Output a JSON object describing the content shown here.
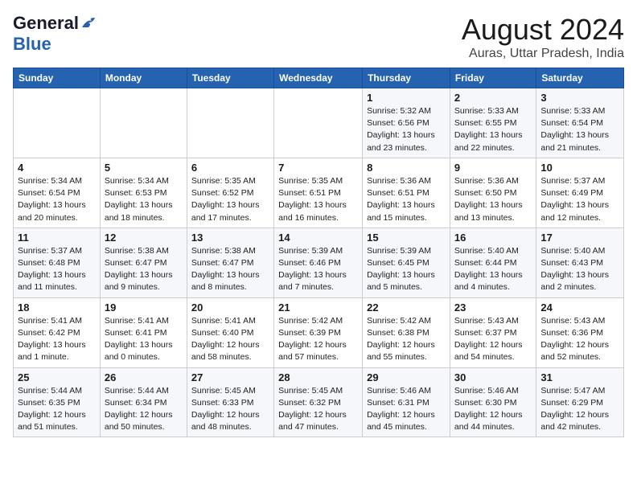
{
  "app": {
    "logo_line1": "General",
    "logo_line2": "Blue",
    "main_title": "August 2024",
    "subtitle": "Auras, Uttar Pradesh, India"
  },
  "calendar": {
    "headers": [
      "Sunday",
      "Monday",
      "Tuesday",
      "Wednesday",
      "Thursday",
      "Friday",
      "Saturday"
    ],
    "weeks": [
      [
        {
          "day": "",
          "info": ""
        },
        {
          "day": "",
          "info": ""
        },
        {
          "day": "",
          "info": ""
        },
        {
          "day": "",
          "info": ""
        },
        {
          "day": "1",
          "info": "Sunrise: 5:32 AM\nSunset: 6:56 PM\nDaylight: 13 hours\nand 23 minutes."
        },
        {
          "day": "2",
          "info": "Sunrise: 5:33 AM\nSunset: 6:55 PM\nDaylight: 13 hours\nand 22 minutes."
        },
        {
          "day": "3",
          "info": "Sunrise: 5:33 AM\nSunset: 6:54 PM\nDaylight: 13 hours\nand 21 minutes."
        }
      ],
      [
        {
          "day": "4",
          "info": "Sunrise: 5:34 AM\nSunset: 6:54 PM\nDaylight: 13 hours\nand 20 minutes."
        },
        {
          "day": "5",
          "info": "Sunrise: 5:34 AM\nSunset: 6:53 PM\nDaylight: 13 hours\nand 18 minutes."
        },
        {
          "day": "6",
          "info": "Sunrise: 5:35 AM\nSunset: 6:52 PM\nDaylight: 13 hours\nand 17 minutes."
        },
        {
          "day": "7",
          "info": "Sunrise: 5:35 AM\nSunset: 6:51 PM\nDaylight: 13 hours\nand 16 minutes."
        },
        {
          "day": "8",
          "info": "Sunrise: 5:36 AM\nSunset: 6:51 PM\nDaylight: 13 hours\nand 15 minutes."
        },
        {
          "day": "9",
          "info": "Sunrise: 5:36 AM\nSunset: 6:50 PM\nDaylight: 13 hours\nand 13 minutes."
        },
        {
          "day": "10",
          "info": "Sunrise: 5:37 AM\nSunset: 6:49 PM\nDaylight: 13 hours\nand 12 minutes."
        }
      ],
      [
        {
          "day": "11",
          "info": "Sunrise: 5:37 AM\nSunset: 6:48 PM\nDaylight: 13 hours\nand 11 minutes."
        },
        {
          "day": "12",
          "info": "Sunrise: 5:38 AM\nSunset: 6:47 PM\nDaylight: 13 hours\nand 9 minutes."
        },
        {
          "day": "13",
          "info": "Sunrise: 5:38 AM\nSunset: 6:47 PM\nDaylight: 13 hours\nand 8 minutes."
        },
        {
          "day": "14",
          "info": "Sunrise: 5:39 AM\nSunset: 6:46 PM\nDaylight: 13 hours\nand 7 minutes."
        },
        {
          "day": "15",
          "info": "Sunrise: 5:39 AM\nSunset: 6:45 PM\nDaylight: 13 hours\nand 5 minutes."
        },
        {
          "day": "16",
          "info": "Sunrise: 5:40 AM\nSunset: 6:44 PM\nDaylight: 13 hours\nand 4 minutes."
        },
        {
          "day": "17",
          "info": "Sunrise: 5:40 AM\nSunset: 6:43 PM\nDaylight: 13 hours\nand 2 minutes."
        }
      ],
      [
        {
          "day": "18",
          "info": "Sunrise: 5:41 AM\nSunset: 6:42 PM\nDaylight: 13 hours\nand 1 minute."
        },
        {
          "day": "19",
          "info": "Sunrise: 5:41 AM\nSunset: 6:41 PM\nDaylight: 13 hours\nand 0 minutes."
        },
        {
          "day": "20",
          "info": "Sunrise: 5:41 AM\nSunset: 6:40 PM\nDaylight: 12 hours\nand 58 minutes."
        },
        {
          "day": "21",
          "info": "Sunrise: 5:42 AM\nSunset: 6:39 PM\nDaylight: 12 hours\nand 57 minutes."
        },
        {
          "day": "22",
          "info": "Sunrise: 5:42 AM\nSunset: 6:38 PM\nDaylight: 12 hours\nand 55 minutes."
        },
        {
          "day": "23",
          "info": "Sunrise: 5:43 AM\nSunset: 6:37 PM\nDaylight: 12 hours\nand 54 minutes."
        },
        {
          "day": "24",
          "info": "Sunrise: 5:43 AM\nSunset: 6:36 PM\nDaylight: 12 hours\nand 52 minutes."
        }
      ],
      [
        {
          "day": "25",
          "info": "Sunrise: 5:44 AM\nSunset: 6:35 PM\nDaylight: 12 hours\nand 51 minutes."
        },
        {
          "day": "26",
          "info": "Sunrise: 5:44 AM\nSunset: 6:34 PM\nDaylight: 12 hours\nand 50 minutes."
        },
        {
          "day": "27",
          "info": "Sunrise: 5:45 AM\nSunset: 6:33 PM\nDaylight: 12 hours\nand 48 minutes."
        },
        {
          "day": "28",
          "info": "Sunrise: 5:45 AM\nSunset: 6:32 PM\nDaylight: 12 hours\nand 47 minutes."
        },
        {
          "day": "29",
          "info": "Sunrise: 5:46 AM\nSunset: 6:31 PM\nDaylight: 12 hours\nand 45 minutes."
        },
        {
          "day": "30",
          "info": "Sunrise: 5:46 AM\nSunset: 6:30 PM\nDaylight: 12 hours\nand 44 minutes."
        },
        {
          "day": "31",
          "info": "Sunrise: 5:47 AM\nSunset: 6:29 PM\nDaylight: 12 hours\nand 42 minutes."
        }
      ]
    ]
  }
}
